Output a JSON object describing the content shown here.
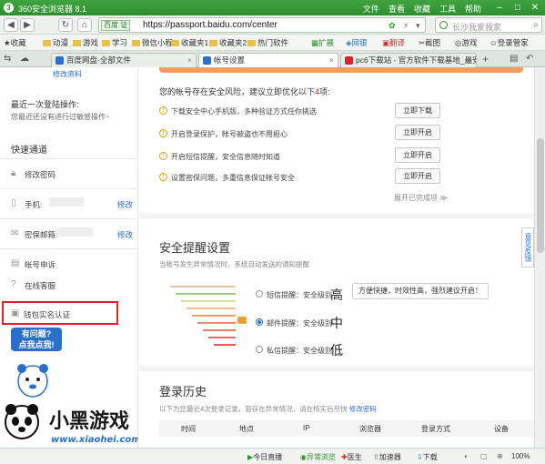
{
  "window": {
    "logo": "3",
    "title": "360安全浏览器 8.1",
    "menus": [
      "文件",
      "查看",
      "收藏",
      "工具",
      "帮助"
    ],
    "controls": [
      "–",
      "□",
      "✕"
    ]
  },
  "nav": {
    "back": "◀",
    "forward": "▶",
    "refresh": "↻",
    "home": "⌂",
    "url_prefix": "百度 证",
    "url": "https://passport.baidu.com/center",
    "lightning": "⚡",
    "search_placeholder": "长沙我爱我家"
  },
  "bookmarks": [
    "收藏",
    "动漫",
    "游戏",
    "学习",
    "微信小程",
    "收藏夹1",
    "收藏夹2",
    "热门软件",
    "扩展",
    "网银",
    "翻译",
    "截图",
    "游戏",
    "登录管家"
  ],
  "tabs": [
    {
      "label": "百度网盘-全部文件",
      "active": false
    },
    {
      "label": "帐号设置",
      "active": true
    },
    {
      "label": "pc6下载站 - 官方软件下载基地_最安",
      "active": false
    }
  ],
  "sidebar": {
    "manage_link": "修改资料",
    "last_login_label": "最近一次登陆操作:",
    "last_login_text": "您最近还没有进行过敏感操作~",
    "quick_title": "快速通道",
    "items": [
      {
        "icon": "lock-icon",
        "label": "修改密码",
        "action": ""
      },
      {
        "icon": "phone-icon",
        "label": "手机:",
        "action": "修改"
      },
      {
        "icon": "mail-icon",
        "label": "密保邮箱:",
        "action": "修改"
      },
      {
        "icon": "doc-icon",
        "label": "帐号申诉",
        "action": ""
      },
      {
        "icon": "help-icon",
        "label": "在线客服",
        "action": ""
      },
      {
        "icon": "card-icon",
        "label": "钱包实名认证",
        "action": ""
      }
    ],
    "help_bubble": [
      "有问题?",
      "点我点我!"
    ]
  },
  "main": {
    "risk_header_a": "您的帐号存在安全风险，建议立即优化以下",
    "risk_count": "4",
    "risk_header_b": "项:",
    "tasks": [
      {
        "label": "下载安全中心手机版，多种验证方式任你挑选",
        "button": "立即下载"
      },
      {
        "label": "开启登录保护，帐号被盗也不用担心",
        "button": "立即开启"
      },
      {
        "label": "开启短信提醒，安全信息随时知道",
        "button": "立即开启"
      },
      {
        "label": "设置密保问题，多重信息保证帐号安全",
        "button": "立即开启"
      }
    ],
    "expand": "展开已完成项 ≫",
    "alert_title": "安全提醒设置",
    "alert_sub": "当帐号发生异常情况时，系统自动发送的通知提醒",
    "levels": [
      {
        "label": "短信提醒：安全级别",
        "level": "高",
        "selected": false
      },
      {
        "label": "邮件提醒：安全级别",
        "level": "中",
        "selected": true
      },
      {
        "label": "私信提醒：安全级别",
        "level": "低",
        "selected": false
      }
    ],
    "tooltip": "方便快捷，时效性高，强烈建议开启！",
    "history_title": "登录历史",
    "history_sub_a": "以下为您最近4次登录记录，若存在异常情况，请在核实后尽快",
    "history_sub_link": "修改密码",
    "columns": [
      "时间",
      "地点",
      "IP",
      "浏览器",
      "登录方式",
      "设备"
    ]
  },
  "feedback": "意见反馈",
  "watermark": {
    "brand": "小黑游戏",
    "url": "www.xiaohei.com"
  },
  "status": {
    "items": [
      "今日直播",
      "异常浏览",
      "医生",
      "加速器",
      "下载"
    ],
    "zoom": "100%"
  },
  "colors": {
    "accent": "#2f8f30",
    "link": "#2a6fc9",
    "warning": "#e0a400",
    "highlight_box": "#e0202a"
  }
}
